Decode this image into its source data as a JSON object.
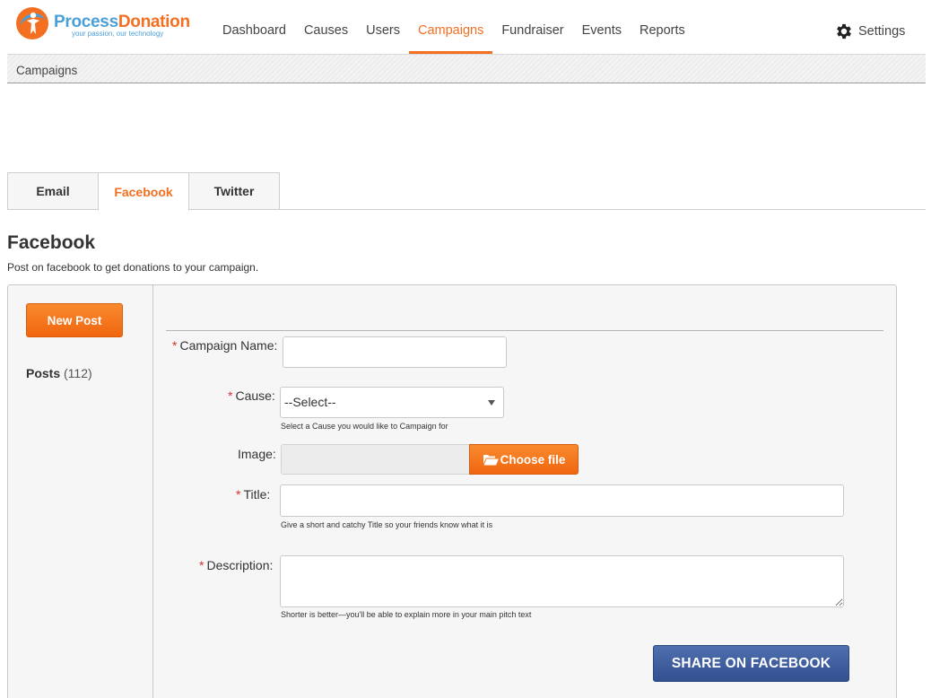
{
  "brand": {
    "name_part1": "Process",
    "name_part2": "Donation",
    "tagline": "your passion, our technology",
    "colors": {
      "primary": "#f36f21",
      "secondary": "#4a9fd8",
      "facebook": "#3b5998"
    }
  },
  "nav": {
    "items": [
      {
        "label": "Dashboard"
      },
      {
        "label": "Causes"
      },
      {
        "label": "Users"
      },
      {
        "label": "Campaigns",
        "active": true
      },
      {
        "label": "Fundraiser"
      },
      {
        "label": "Events"
      },
      {
        "label": "Reports"
      }
    ],
    "settings_label": "Settings",
    "settings_icon": "gear-icon"
  },
  "breadcrumb": {
    "current": "Campaigns"
  },
  "tabs": [
    {
      "label": "Email"
    },
    {
      "label": "Facebook",
      "active": true
    },
    {
      "label": "Twitter"
    }
  ],
  "page": {
    "title": "Facebook",
    "subtitle": "Post on facebook to get donations to your campaign."
  },
  "sidebar": {
    "new_post_label": "New Post",
    "posts_label": "Posts",
    "posts_count": "(112)"
  },
  "form": {
    "required_marker": "*",
    "campaign_name": {
      "label": "Campaign Name:",
      "value": ""
    },
    "cause": {
      "label": "Cause:",
      "selected": "--Select--",
      "hint": "Select a Cause you would like to Campaign for"
    },
    "image": {
      "label": "Image:",
      "button_label": "Choose file",
      "button_icon": "folder-open-icon"
    },
    "title": {
      "label": "Title:",
      "value": "",
      "hint": "Give a short and catchy Title so your friends know what it is"
    },
    "description": {
      "label": "Description:",
      "value": "",
      "hint": "Shorter is better—you'll be able to explain more in your main pitch text"
    },
    "submit_label": "SHARE ON FACEBOOK"
  }
}
